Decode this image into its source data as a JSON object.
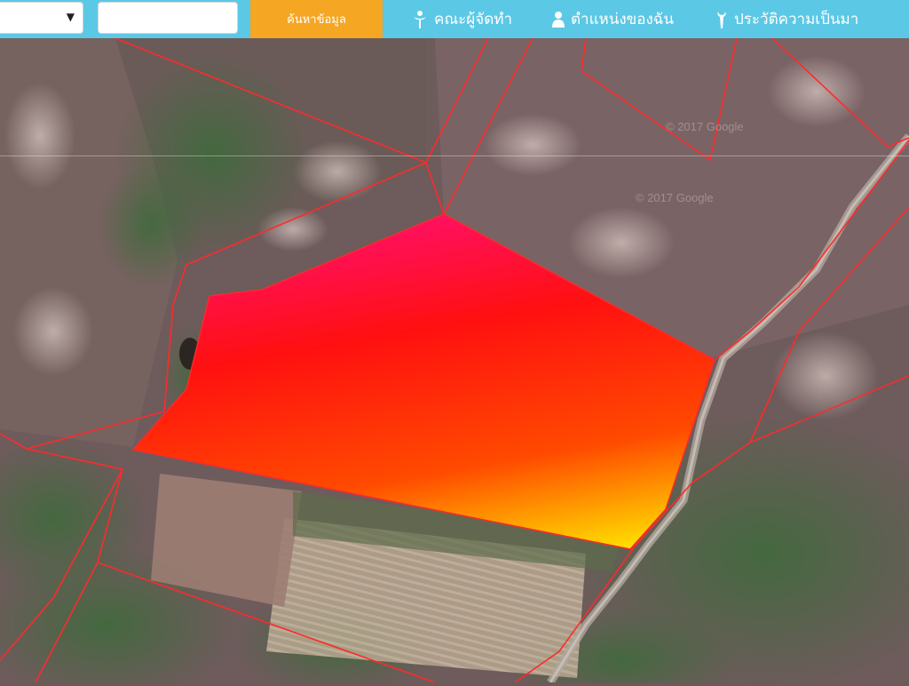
{
  "toolbar": {
    "province_select_value": "",
    "search_input_value": "",
    "search_input_placeholder": "",
    "search_button_label": "ค้นหาข้อมูล"
  },
  "nav": {
    "committee_label": "คณะผู้จัดทำ",
    "my_location_label": "ตำแหน่งของฉัน",
    "history_label": "ประวัติความเป็นมา"
  },
  "map": {
    "attribution": "© 2017 Google",
    "attribution_2": "© 2017 Google",
    "parcel_boundary_color": "#ff2a2a",
    "highlight_colors": [
      "#ff1060",
      "#ff1010",
      "#ff4a00",
      "#ffe000"
    ],
    "accent_color": "#5bc8e6",
    "button_color": "#f5a623"
  }
}
